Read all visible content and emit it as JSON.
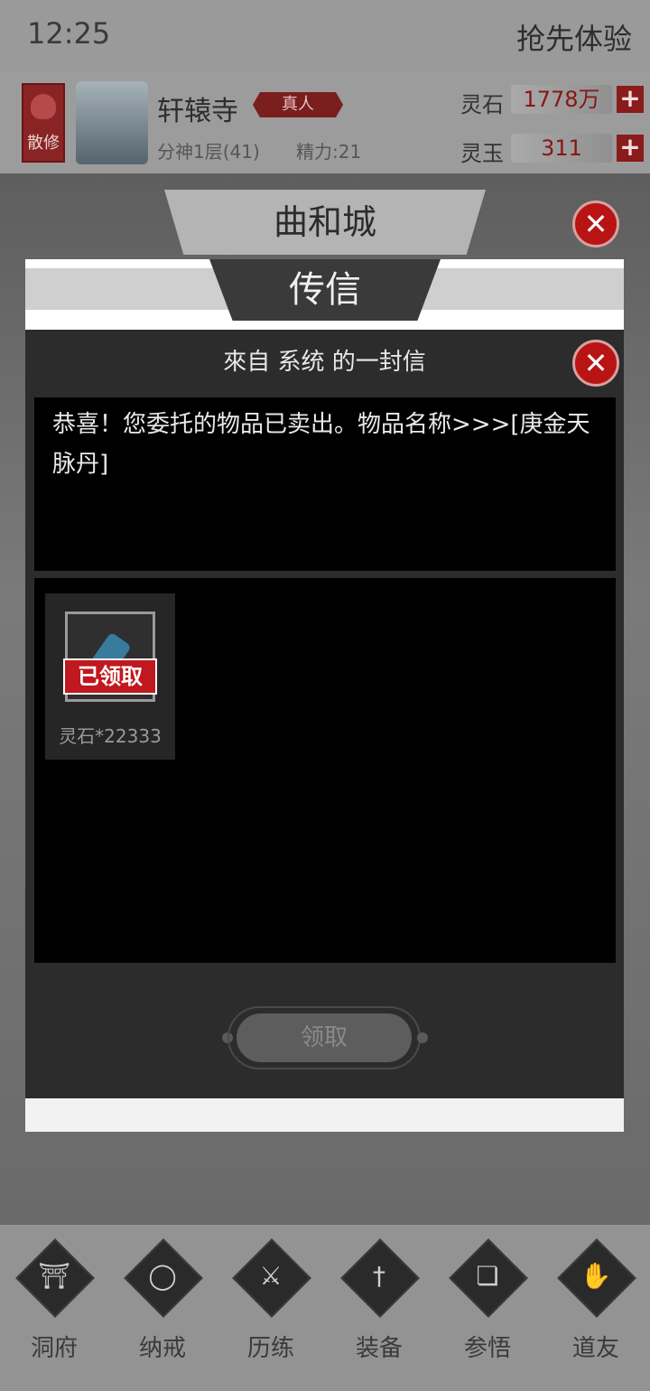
{
  "status_bar": {
    "time": "12:25",
    "promo": "抢先体验"
  },
  "header": {
    "sect_label": "散修",
    "player_name": "轩辕寺",
    "rank_badge": "真人",
    "realm": "分神1层(41)",
    "energy": "精力:21",
    "resources": [
      {
        "label": "灵石",
        "value": "1778万"
      },
      {
        "label": "灵玉",
        "value": "311"
      }
    ]
  },
  "city": {
    "name": "曲和城"
  },
  "dialog": {
    "title": "传信",
    "subtitle": "來自  系统  的一封信",
    "message": "恭喜！您委托的物品已卖出。物品名称>>>[庚金天脉丹]",
    "attachments": [
      {
        "name_qty": "灵石*22333",
        "stamp": "已领取",
        "icon": "spirit-stone-icon"
      }
    ],
    "claim_button": "领取"
  },
  "nav": {
    "items": [
      {
        "label": "洞府",
        "icon": "cave-gate-icon"
      },
      {
        "label": "纳戒",
        "icon": "ring-icon"
      },
      {
        "label": "历练",
        "icon": "crossed-swords-icon"
      },
      {
        "label": "装备",
        "icon": "sword-icon"
      },
      {
        "label": "参悟",
        "icon": "open-book-icon"
      },
      {
        "label": "道友",
        "icon": "handshake-icon"
      }
    ]
  },
  "colors": {
    "accent_red": "#b81414",
    "panel_dark": "#2c2c2c",
    "message_bg": "#000000"
  }
}
